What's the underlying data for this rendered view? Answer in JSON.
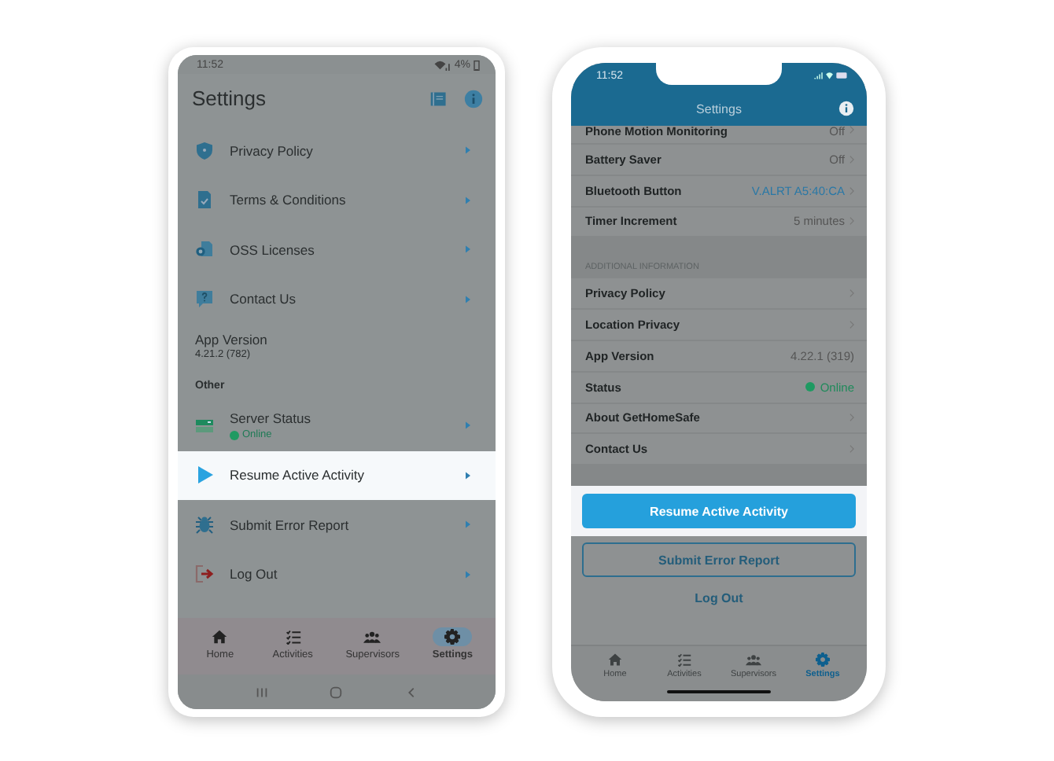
{
  "android": {
    "status_bar": {
      "time": "11:52",
      "battery": "4%"
    },
    "title": "Settings",
    "items": [
      {
        "kind": "link",
        "label": "Privacy Policy",
        "highlighted": false
      },
      {
        "kind": "link",
        "label": "Terms & Conditions",
        "highlighted": false
      },
      {
        "kind": "link",
        "label": "OSS Licenses",
        "highlighted": false
      },
      {
        "kind": "link",
        "label": "Contact Us",
        "highlighted": false
      },
      {
        "kind": "info",
        "label": "App Version",
        "value": "4.21.2 (782)"
      },
      {
        "kind": "heading",
        "label": "Other"
      },
      {
        "kind": "status",
        "label": "Server Status",
        "status": "Online",
        "highlighted": false
      },
      {
        "kind": "link",
        "label": "Resume Active Activity",
        "highlighted": true
      },
      {
        "kind": "link",
        "label": "Submit Error Report",
        "highlighted": false
      },
      {
        "kind": "link",
        "label": "Log Out",
        "highlighted": false
      }
    ],
    "tabs": [
      {
        "label": "Home",
        "selected": false
      },
      {
        "label": "Activities",
        "selected": false
      },
      {
        "label": "Supervisors",
        "selected": false
      },
      {
        "label": "Settings",
        "selected": true
      }
    ]
  },
  "ios": {
    "status_bar": {
      "time": "11:52"
    },
    "title": "Settings",
    "rows": [
      {
        "kind": "plain",
        "label": "Phone Motion Monitoring",
        "value": "Off",
        "chevron": true
      },
      {
        "kind": "plain",
        "label": "Battery Saver",
        "value": "Off",
        "chevron": true
      },
      {
        "kind": "accent",
        "label": "Bluetooth Button",
        "value": "V.ALRT A5:40:CA",
        "chevron": true
      },
      {
        "kind": "plain",
        "label": "Timer Increment",
        "value": "5 minutes",
        "chevron": true
      },
      {
        "kind": "section",
        "label": "ADDITIONAL INFORMATION"
      },
      {
        "kind": "plain",
        "label": "Privacy Policy",
        "chevron": true
      },
      {
        "kind": "plain",
        "label": "Location Privacy",
        "chevron": true
      },
      {
        "kind": "plain",
        "label": "App Version",
        "value": "4.22.1 (319)",
        "chevron": false
      },
      {
        "kind": "status",
        "label": "Status",
        "value": "Online",
        "chevron": false
      },
      {
        "kind": "plain",
        "label": "About GetHomeSafe",
        "chevron": true
      },
      {
        "kind": "plain",
        "label": "Contact Us",
        "chevron": true
      }
    ],
    "buttons": [
      {
        "kind": "filled",
        "label": "Resume Active Activity"
      },
      {
        "kind": "outlined",
        "label": "Submit Error Report"
      },
      {
        "kind": "text",
        "label": "Log Out"
      }
    ],
    "tabs": [
      {
        "label": "Home",
        "selected": false
      },
      {
        "label": "Activities",
        "selected": false
      },
      {
        "label": "Supervisors",
        "selected": false
      },
      {
        "label": "Settings",
        "selected": true
      }
    ]
  }
}
